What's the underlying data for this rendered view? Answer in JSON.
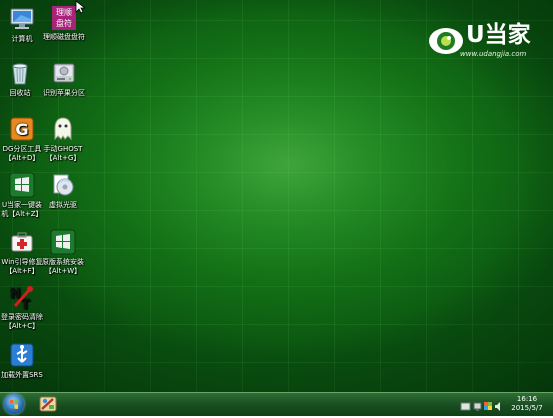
{
  "desktop_icons": [
    {
      "name": "computer",
      "label": "计算机",
      "hotkey": ""
    },
    {
      "name": "lishun-partition",
      "label": "理顺磁盘盘符",
      "hotkey": ""
    },
    {
      "name": "recycle-bin",
      "label": "回收站",
      "hotkey": ""
    },
    {
      "name": "identify-partition",
      "label": "识别苹果分区",
      "hotkey": ""
    },
    {
      "name": "dg-partition",
      "label": "DG分区工具",
      "hotkey": "【Alt+D】"
    },
    {
      "name": "manual-ghost",
      "label": "手动GHOST",
      "hotkey": "【Alt+G】"
    },
    {
      "name": "udangjia-one-click",
      "label": "U当家一键装",
      "hotkey": "机【Alt+Z】"
    },
    {
      "name": "virtual-drive",
      "label": "虚拟光驱",
      "hotkey": ""
    },
    {
      "name": "win-boot-repair",
      "label": "Win引导修复",
      "hotkey": "【Alt+F】"
    },
    {
      "name": "original-install",
      "label": "原版系统安装",
      "hotkey": "【Alt+W】"
    },
    {
      "name": "password-clear",
      "label": "登录密码清除",
      "hotkey": "【Alt+C】"
    },
    {
      "name": "load-external-srs",
      "label": "加载外置SRS",
      "hotkey": ""
    }
  ],
  "lishun_icon_text": [
    "理顺",
    "盘符"
  ],
  "logo": {
    "brand": "U当家",
    "url": "www.udangjia.com"
  },
  "taskbar": {
    "time": "16:16",
    "date": "2015/5/7"
  },
  "colors": {
    "desktop": "#1c7d20",
    "taskbar": "#1b4f22",
    "logo": "#ffffff"
  }
}
